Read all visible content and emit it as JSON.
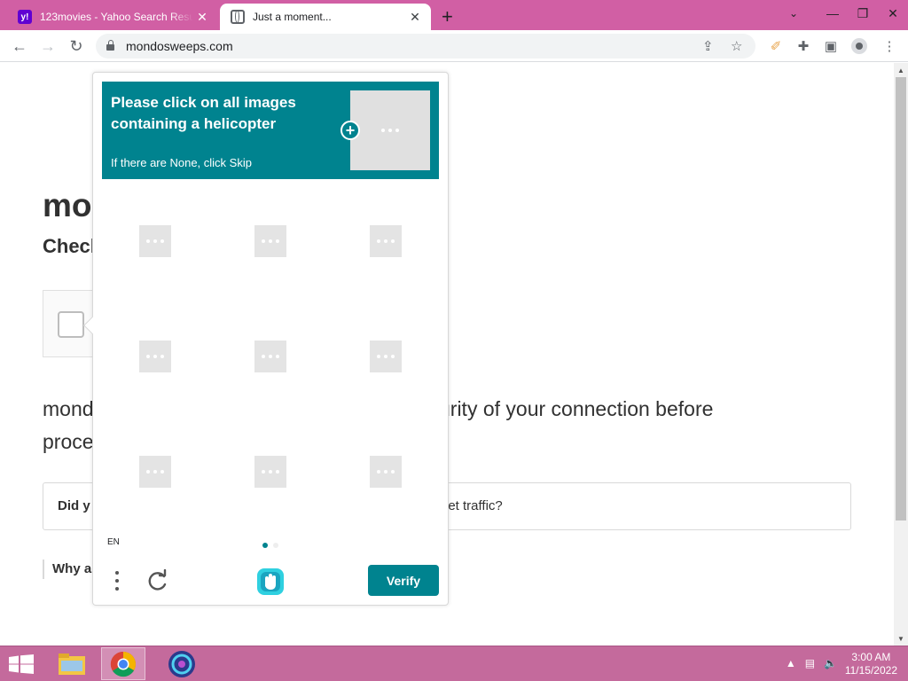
{
  "browser": {
    "tabs": [
      {
        "title": "123movies - Yahoo Search Results",
        "favicon": "yahoo-icon",
        "active": false
      },
      {
        "title": "Just a moment...",
        "favicon": "globe-icon",
        "active": true
      }
    ],
    "new_tab_label": "+",
    "url": "mondosweeps.com"
  },
  "page": {
    "site_title": "mo",
    "site_subtitle": "Check",
    "paragraph": "mondo                                                                         urity of your connection before proce",
    "paragraph_left_1": "mond",
    "paragraph_right_1": "urity of your connection before",
    "paragraph_left_2": "proce",
    "faq_left": "Did y",
    "faq_right": "net traffic?",
    "why_text": "Why a"
  },
  "captcha": {
    "prompt_title": "Please click on all images containing a helicopter",
    "prompt_sub": "If there are None, click Skip",
    "language": "EN",
    "verify_label": "Verify",
    "accent_color": "#00838f",
    "grid_cells": 9,
    "page_index": 1,
    "page_count": 2
  },
  "taskbar": {
    "time": "3:00 AM",
    "date": "11/15/2022",
    "apps": [
      "file-explorer-icon",
      "chrome-icon",
      "browser-app-icon"
    ]
  }
}
